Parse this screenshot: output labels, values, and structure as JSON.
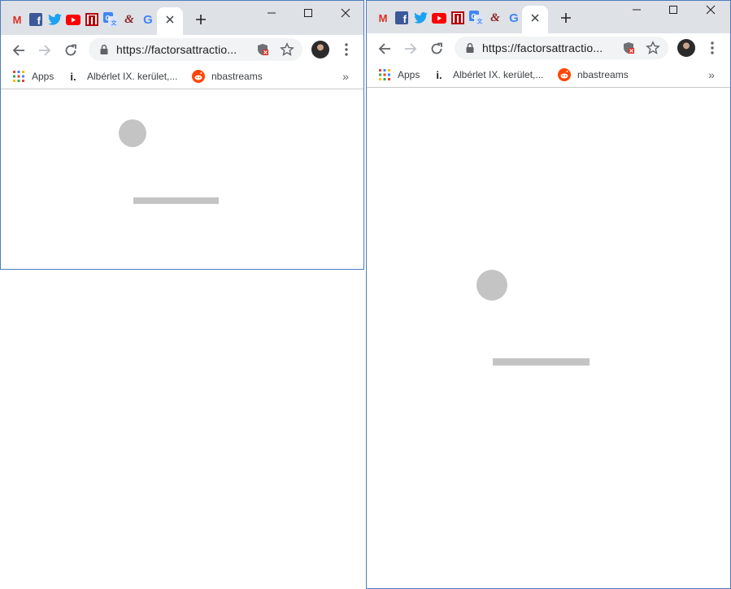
{
  "browser": {
    "url": "https://factorsattractio...",
    "tabs": [
      {
        "icon": "gmail-icon",
        "label": "M"
      },
      {
        "icon": "facebook-icon",
        "label": "f"
      },
      {
        "icon": "twitter-icon"
      },
      {
        "icon": "youtube-icon"
      },
      {
        "icon": "netflix-icon"
      },
      {
        "icon": "google-translate-icon"
      },
      {
        "icon": "ampersand-site-icon",
        "label": "&"
      },
      {
        "icon": "google-icon",
        "label": "G"
      }
    ],
    "bookmarks": [
      {
        "icon": "apps-grid-icon",
        "label": "Apps"
      },
      {
        "icon": "info-favicon-icon",
        "icon_text": "i.",
        "label": "Albérlet IX. kerület,..."
      },
      {
        "icon": "reddit-icon",
        "label": "nbastreams"
      }
    ],
    "bookmarks_overflow": "»",
    "new_tab_symbol": "+",
    "close_symbol": "✕"
  },
  "colors": {
    "tabstrip": "#dee1e6",
    "placeholder": "#c4c4c4",
    "window_border": "#4a7dbd",
    "gmail_red": "#d93025",
    "facebook_blue": "#3b5998",
    "twitter_blue": "#1da1f2",
    "youtube_red": "#ff0000",
    "netflix_red": "#b20710",
    "reddit_orange": "#ff4500"
  }
}
